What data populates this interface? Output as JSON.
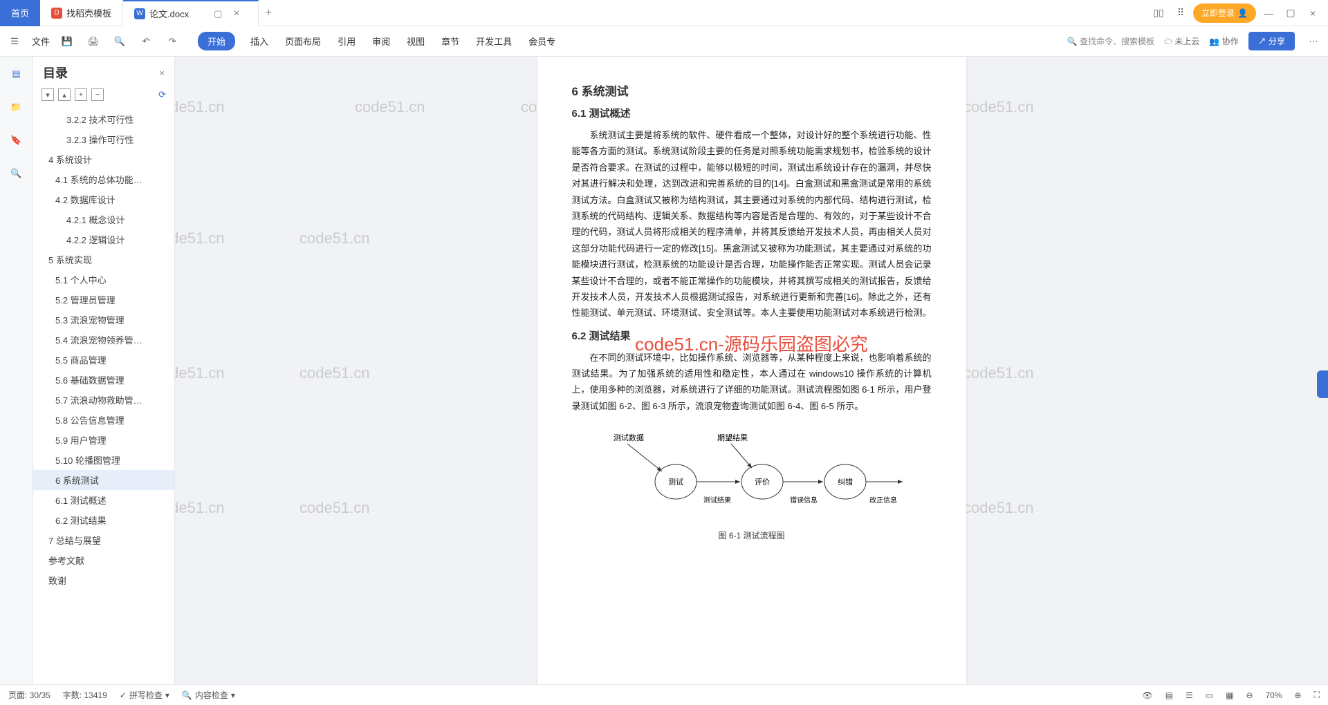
{
  "tabs": {
    "home": "首页",
    "template": "找稻壳模板",
    "document": "论文.docx"
  },
  "titlebar": {
    "login": "立即登录"
  },
  "ribbon": {
    "file": "文件",
    "tabs": [
      "开始",
      "插入",
      "页面布局",
      "引用",
      "审阅",
      "视图",
      "章节",
      "开发工具",
      "会员专"
    ],
    "search": "查找命令、搜索模板",
    "cloud": "未上云",
    "collab": "协作",
    "share": "分享"
  },
  "outline": {
    "title": "目录",
    "items": [
      {
        "t": "3.2.2 技术可行性",
        "lvl": 3
      },
      {
        "t": "3.2.3 操作可行性",
        "lvl": 3
      },
      {
        "t": "4 系统设计",
        "lvl": 1
      },
      {
        "t": "4.1 系统的总体功能…",
        "lvl": 2
      },
      {
        "t": "4.2 数据库设计",
        "lvl": 2
      },
      {
        "t": "4.2.1 概念设计",
        "lvl": 3
      },
      {
        "t": "4.2.2 逻辑设计",
        "lvl": 3
      },
      {
        "t": "5 系统实现",
        "lvl": 1
      },
      {
        "t": "5.1 个人中心",
        "lvl": 2
      },
      {
        "t": "5.2 管理员管理",
        "lvl": 2
      },
      {
        "t": "5.3 流浪宠物管理",
        "lvl": 2
      },
      {
        "t": "5.4 流浪宠物领养管…",
        "lvl": 2
      },
      {
        "t": "5.5 商品管理",
        "lvl": 2
      },
      {
        "t": "5.6 基础数据管理",
        "lvl": 2
      },
      {
        "t": "5.7 流浪动物救助管…",
        "lvl": 2
      },
      {
        "t": "5.8 公告信息管理",
        "lvl": 2
      },
      {
        "t": "5.9 用户管理",
        "lvl": 2
      },
      {
        "t": "5.10 轮播图管理",
        "lvl": 2
      },
      {
        "t": "6 系统测试",
        "lvl": 2,
        "sel": true
      },
      {
        "t": "6.1 测试概述",
        "lvl": 2
      },
      {
        "t": "6.2 测试结果",
        "lvl": 2
      },
      {
        "t": "7 总结与展望",
        "lvl": 1
      },
      {
        "t": "参考文献",
        "lvl": 1
      },
      {
        "t": "致谢",
        "lvl": 1
      }
    ]
  },
  "doc": {
    "h1": "6 系统测试",
    "h2a": "6.1 测试概述",
    "p1": "系统测试主要是将系统的软件、硬件看成一个整体，对设计好的整个系统进行功能、性能等各方面的测试。系统测试阶段主要的任务是对照系统功能需求规划书，检验系统的设计是否符合要求。在测试的过程中，能够以极短的时间，测试出系统设计存在的漏洞，并尽快对其进行解决和处理，达到改进和完善系统的目的[14]。白盒测试和黑盒测试是常用的系统测试方法。白盒测试又被称为结构测试，其主要通过对系统的内部代码、结构进行测试，检测系统的代码结构、逻辑关系、数据结构等内容是否是合理的、有效的，对于某些设计不合理的代码，测试人员将形成相关的程序清单，并将其反馈给开发技术人员，再由相关人员对这部分功能代码进行一定的修改[15]。黑盒测试又被称为功能测试，其主要通过对系统的功能模块进行测试，检测系统的功能设计是否合理，功能操作能否正常实现。测试人员会记录某些设计不合理的，或者不能正常操作的功能模块，并将其撰写成相关的测试报告，反馈给开发技术人员，开发技术人员根据测试报告，对系统进行更新和完善[16]。除此之外，还有性能测试、单元测试、环境测试、安全测试等。本人主要使用功能测试对本系统进行检测。",
    "h2b": "6.2 测试结果",
    "p2": "在不同的测试环境中，比如操作系统、浏览器等，从某种程度上来说，也影响着系统的测试结果。为了加强系统的适用性和稳定性，本人通过在 windows10 操作系统的计算机上，使用多种的浏览器，对系统进行了详细的功能测试。测试流程图如图 6-1 所示，用户登录测试如图 6-2、图 6-3 所示，流浪宠物查询测试如图 6-4、图 6-5 所示。",
    "diagram": {
      "inputs": "测试数据",
      "expected": "期望结果",
      "node1": "测试",
      "node2": "评价",
      "node3": "纠错",
      "lbl1": "测试结果",
      "lbl2": "错误信息",
      "lbl3": "改正信息",
      "caption": "图 6-1 测试流程图"
    },
    "watermark_red": "code51.cn-源码乐园盗图必究",
    "watermark": "code51.cn"
  },
  "status": {
    "page": "页面: 30/35",
    "words": "字数: 13419",
    "spell": "拼写检查",
    "content": "内容检查",
    "zoom": "70%"
  }
}
